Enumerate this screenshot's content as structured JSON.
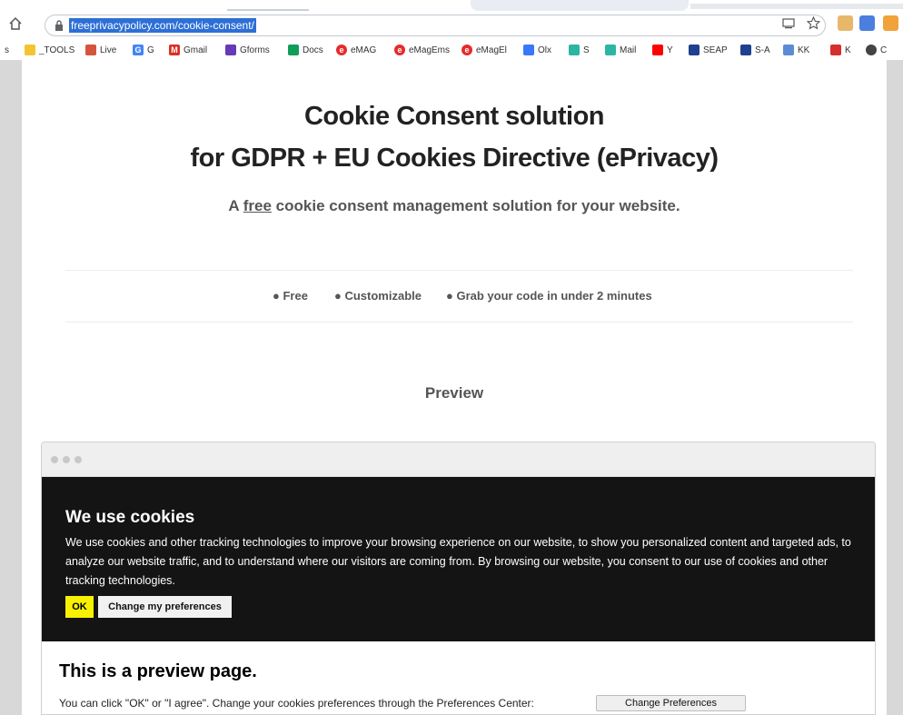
{
  "browser": {
    "url": "freeprivacypolicy.com/cookie-consent/"
  },
  "bookmarks": [
    {
      "label": "s",
      "icon": "bookmark-fragment-icon",
      "color": "#666666"
    },
    {
      "label": "_TOOLS",
      "icon": "folder-icon",
      "color": "#f4c430"
    },
    {
      "label": "Live",
      "icon": "live-icon",
      "color": "#d4553b"
    },
    {
      "label": "G",
      "icon": "google-icon",
      "color": "#4285f4"
    },
    {
      "label": "Gmail",
      "icon": "gmail-icon",
      "color": "#d93025"
    },
    {
      "label": "Gforms",
      "icon": "gforms-icon",
      "color": "#673ab7"
    },
    {
      "label": "Docs",
      "icon": "docs-icon",
      "color": "#0f9d58"
    },
    {
      "label": "eMAG",
      "icon": "emag-icon",
      "color": "#e52b2b"
    },
    {
      "label": "eMagEms",
      "icon": "emag-icon",
      "color": "#e52b2b"
    },
    {
      "label": "eMagEl",
      "icon": "emag-icon",
      "color": "#e52b2b"
    },
    {
      "label": "Olx",
      "icon": "olx-icon",
      "color": "#3a77ff"
    },
    {
      "label": "S",
      "icon": "s-icon",
      "color": "#2db5a3"
    },
    {
      "label": "Mail",
      "icon": "mail-icon",
      "color": "#2db5a3"
    },
    {
      "label": "Y",
      "icon": "youtube-icon",
      "color": "#ff0000"
    },
    {
      "label": "SEAP",
      "icon": "seap-icon",
      "color": "#1f3f8f"
    },
    {
      "label": "S-A",
      "icon": "s-a-icon",
      "color": "#1f3f8f"
    },
    {
      "label": "KK",
      "icon": "kk-icon",
      "color": "#5c8bd6"
    },
    {
      "label": "K",
      "icon": "k-icon",
      "color": "#d62e2e"
    },
    {
      "label": "C",
      "icon": "c-icon",
      "color": "#444444"
    }
  ],
  "hero": {
    "title_line1": "Cookie Consent solution",
    "title_line2": "for GDPR + EU Cookies Directive (ePrivacy)",
    "tagline_prefix": "A ",
    "tagline_link": "free",
    "tagline_suffix": " cookie consent management solution for your website."
  },
  "features": [
    "● Free",
    "● Customizable",
    "● Grab your code in under 2 minutes"
  ],
  "preview": {
    "heading": "Preview",
    "banner_title": "We use cookies",
    "banner_text": "We use cookies and other tracking technologies to improve your browsing experience on our website, to show you personalized content and targeted ads, to analyze our website traffic, and to understand where our visitors are coming from. By browsing our website, you consent to our use of cookies and other tracking technologies.",
    "ok_label": "OK",
    "prefs_label": "Change my preferences",
    "page_heading": "This is a preview page.",
    "page_text": "You can click \"OK\" or \"I agree\". Change your cookies preferences through the Preferences Center:",
    "page_button": "Change Preferences"
  },
  "colors": {
    "banner_bg": "#141414",
    "ok_button": "#f8f200",
    "url_highlight": "#2d6fd6"
  }
}
